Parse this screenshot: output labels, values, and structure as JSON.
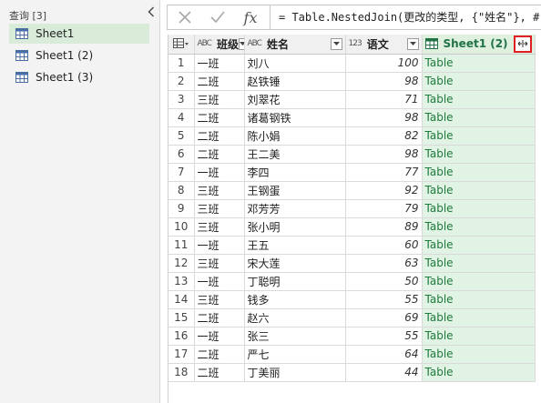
{
  "queries": {
    "header": "查询 [3]",
    "items": [
      {
        "label": "Sheet1",
        "selected": true
      },
      {
        "label": "Sheet1 (2)",
        "selected": false
      },
      {
        "label": "Sheet1 (3)",
        "selected": false
      }
    ]
  },
  "formula": {
    "text": "= Table.NestedJoin(更改的类型, {\"姓名\"}, #\"Sh"
  },
  "grid": {
    "columns": [
      {
        "type_icon": "ABC",
        "name": "班级"
      },
      {
        "type_icon": "ABC",
        "name": "姓名"
      },
      {
        "type_icon": "123",
        "name": "语文"
      },
      {
        "name": "Sheet1 (2)"
      }
    ],
    "rows": [
      {
        "n": "1",
        "class": "一班",
        "name": "刘八",
        "score": "100",
        "sheet": "Table"
      },
      {
        "n": "2",
        "class": "二班",
        "name": "赵铁锤",
        "score": "98",
        "sheet": "Table"
      },
      {
        "n": "3",
        "class": "三班",
        "name": "刘翠花",
        "score": "71",
        "sheet": "Table"
      },
      {
        "n": "4",
        "class": "二班",
        "name": "诸葛钢铁",
        "score": "98",
        "sheet": "Table"
      },
      {
        "n": "5",
        "class": "二班",
        "name": "陈小娟",
        "score": "82",
        "sheet": "Table"
      },
      {
        "n": "6",
        "class": "二班",
        "name": "王二美",
        "score": "98",
        "sheet": "Table"
      },
      {
        "n": "7",
        "class": "一班",
        "name": "李四",
        "score": "77",
        "sheet": "Table"
      },
      {
        "n": "8",
        "class": "三班",
        "name": "王钢蛋",
        "score": "92",
        "sheet": "Table"
      },
      {
        "n": "9",
        "class": "三班",
        "name": "邓芳芳",
        "score": "79",
        "sheet": "Table"
      },
      {
        "n": "10",
        "class": "三班",
        "name": "张小明",
        "score": "89",
        "sheet": "Table"
      },
      {
        "n": "11",
        "class": "一班",
        "name": "王五",
        "score": "60",
        "sheet": "Table"
      },
      {
        "n": "12",
        "class": "三班",
        "name": "宋大莲",
        "score": "63",
        "sheet": "Table"
      },
      {
        "n": "13",
        "class": "一班",
        "name": "丁聪明",
        "score": "50",
        "sheet": "Table"
      },
      {
        "n": "14",
        "class": "三班",
        "name": "钱多",
        "score": "55",
        "sheet": "Table"
      },
      {
        "n": "15",
        "class": "二班",
        "name": "赵六",
        "score": "69",
        "sheet": "Table"
      },
      {
        "n": "16",
        "class": "一班",
        "name": "张三",
        "score": "55",
        "sheet": "Table"
      },
      {
        "n": "17",
        "class": "二班",
        "name": "严七",
        "score": "64",
        "sheet": "Table"
      },
      {
        "n": "18",
        "class": "二班",
        "name": "丁美丽",
        "score": "44",
        "sheet": "Table"
      }
    ]
  }
}
